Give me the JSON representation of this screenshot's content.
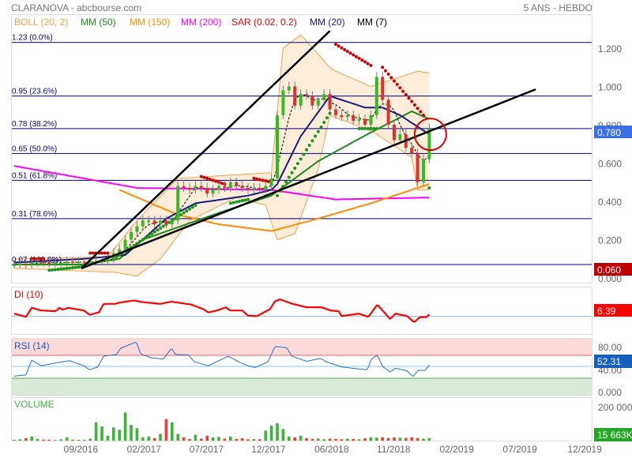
{
  "header": {
    "title": "CLARANOVA - abcbourse.com",
    "period": "5 ANS - HEBDO"
  },
  "legend": [
    {
      "label": "BOLL (20, 2)",
      "color": "#f5a04a"
    },
    {
      "label": "MM (50)",
      "color": "#1a8a1a"
    },
    {
      "label": "MM (150)",
      "color": "#ff8c00"
    },
    {
      "label": "MM (200)",
      "color": "#ff00ff"
    },
    {
      "label": "SAR (0.02, 0.2)",
      "color": "#e00000"
    },
    {
      "label": "MM (20)",
      "color": "#1a1a80"
    },
    {
      "label": "MM (7)",
      "color": "#000000"
    }
  ],
  "badges": {
    "last_price": "0.780",
    "last_price_color": "#3a6fe8",
    "sar": "0.060",
    "sar_color": "#c00000",
    "di": "6.39",
    "di_color": "#ff0000",
    "rsi": "52.31",
    "rsi_color": "#1560bd",
    "volume": "15 663K",
    "volume_color": "#22a822"
  },
  "panels": {
    "di": "DI (10)",
    "rsi": "RSI (14)",
    "volume": "VOLUME"
  },
  "chart_data": {
    "type": "candlestick",
    "title": "CLARANOVA - abcbourse.com",
    "x_unit": "bi-weekly index",
    "x_ticks": [
      {
        "label": "09/2016",
        "i": 11.4
      },
      {
        "label": "02/2017",
        "i": 22.2
      },
      {
        "label": "07/2017",
        "i": 32.9
      },
      {
        "label": "12/2017",
        "i": 43.5
      },
      {
        "label": "06/2018",
        "i": 54.3
      },
      {
        "label": "11/2018",
        "i": 64.9
      },
      {
        "label": "02/2019",
        "i": 75.7
      },
      {
        "label": "07/2019",
        "i": 86.5
      },
      {
        "label": "12/2019",
        "i": 97.6
      }
    ],
    "y_ticks": [
      "0.000",
      "0.200",
      "0.400",
      "0.600",
      "0.800",
      "1.000",
      "1.200"
    ],
    "ylim": [
      0,
      1.3
    ],
    "close": [
      0.07,
      0.075,
      0.07,
      0.08,
      0.085,
      0.08,
      0.075,
      0.08,
      0.08,
      0.085,
      0.08,
      0.085,
      0.08,
      0.085,
      0.09,
      0.09,
      0.1,
      0.13,
      0.15,
      0.2,
      0.24,
      0.27,
      0.3,
      0.3,
      0.28,
      0.3,
      0.28,
      0.3,
      0.48,
      0.47,
      0.46,
      0.48,
      0.47,
      0.44,
      0.46,
      0.48,
      0.47,
      0.5,
      0.48,
      0.47,
      0.46,
      0.47,
      0.46,
      0.48,
      0.52,
      0.85,
      0.98,
      1.0,
      0.9,
      0.96,
      0.95,
      0.9,
      0.93,
      0.96,
      0.88,
      0.85,
      0.84,
      0.85,
      0.82,
      0.83,
      0.8,
      0.85,
      1.05,
      0.93,
      0.8,
      0.72,
      0.75,
      0.68,
      0.65,
      0.5,
      0.62,
      0.78
    ],
    "fibonacci": [
      {
        "label": "1.23  (0.0%)",
        "value": 1.23
      },
      {
        "label": "0.95  (23.6%)",
        "value": 0.95
      },
      {
        "label": "0.78  (38.2%)",
        "value": 0.78
      },
      {
        "label": "0.65  (50.0%)",
        "value": 0.65
      },
      {
        "label": "0.51  (61.8%)",
        "value": 0.51
      },
      {
        "label": "0.31  (78.6%)",
        "value": 0.31
      },
      {
        "label": "0.07  (100.0%)",
        "value": 0.07
      }
    ],
    "boll_upper": [
      [
        0,
        0.1
      ],
      [
        16,
        0.11
      ],
      [
        21,
        0.3
      ],
      [
        28,
        0.52
      ],
      [
        44,
        0.55
      ],
      [
        46,
        1.2
      ],
      [
        49,
        1.27
      ],
      [
        54,
        1.1
      ],
      [
        55,
        1.08
      ],
      [
        61,
        1.0
      ],
      [
        69,
        1.08
      ],
      [
        71,
        1.07
      ]
    ],
    "boll_lower": [
      [
        0,
        0.05
      ],
      [
        17,
        0.03
      ],
      [
        21,
        0.01
      ],
      [
        25,
        0.1
      ],
      [
        30,
        0.3
      ],
      [
        38,
        0.42
      ],
      [
        43,
        0.38
      ],
      [
        45,
        0.2
      ],
      [
        48,
        0.23
      ],
      [
        52,
        0.57
      ],
      [
        54,
        0.85
      ],
      [
        61,
        0.77
      ],
      [
        68,
        0.63
      ],
      [
        69,
        0.46
      ],
      [
        71,
        0.46
      ]
    ],
    "mm50": [
      [
        0,
        0.07
      ],
      [
        12,
        0.07
      ],
      [
        18,
        0.1
      ],
      [
        22,
        0.2
      ],
      [
        35,
        0.34
      ],
      [
        44,
        0.43
      ],
      [
        52,
        0.61
      ],
      [
        61,
        0.76
      ],
      [
        68,
        0.87
      ],
      [
        71,
        0.83
      ]
    ],
    "mm150": [
      [
        18,
        0.46
      ],
      [
        28,
        0.33
      ],
      [
        35,
        0.28
      ],
      [
        44,
        0.245
      ],
      [
        52,
        0.31
      ],
      [
        61,
        0.39
      ],
      [
        71,
        0.49
      ]
    ],
    "mm200": [
      [
        0,
        0.585
      ],
      [
        21,
        0.47
      ],
      [
        44,
        0.46
      ],
      [
        55,
        0.41
      ],
      [
        71,
        0.42
      ]
    ],
    "mm20": [
      [
        0,
        0.08
      ],
      [
        12,
        0.1
      ],
      [
        19,
        0.12
      ],
      [
        26,
        0.31
      ],
      [
        31,
        0.39
      ],
      [
        40,
        0.43
      ],
      [
        44,
        0.46
      ],
      [
        45,
        0.49
      ],
      [
        49,
        0.74
      ],
      [
        54,
        0.95
      ],
      [
        60,
        0.89
      ],
      [
        63,
        0.89
      ],
      [
        66,
        0.85
      ],
      [
        71,
        0.75
      ]
    ],
    "sar": [
      {
        "color": "red",
        "from": 3,
        "to": 5,
        "start": 0.1,
        "end": 0.1
      },
      {
        "color": "green",
        "from": 6,
        "to": 12,
        "start": 0.04,
        "end": 0.06
      },
      {
        "color": "red",
        "from": 13,
        "to": 16,
        "start": 0.13,
        "end": 0.13
      },
      {
        "color": "green",
        "from": 17,
        "to": 31,
        "start": 0.1,
        "end": 0.38
      },
      {
        "color": "red",
        "from": 32,
        "to": 36,
        "start": 0.53,
        "end": 0.49
      },
      {
        "color": "green",
        "from": 37,
        "to": 40,
        "start": 0.39,
        "end": 0.41
      },
      {
        "color": "red",
        "from": 41,
        "to": 44,
        "start": 0.52,
        "end": 0.5
      },
      {
        "color": "green",
        "from": 45,
        "to": 54,
        "start": 0.43,
        "end": 0.86
      },
      {
        "color": "red",
        "from": 55,
        "to": 61,
        "start": 1.22,
        "end": 1.11
      },
      {
        "color": "green",
        "from": 59,
        "to": 62,
        "start": 0.78,
        "end": 0.78
      },
      {
        "color": "red",
        "from": 63,
        "to": 70,
        "start": 1.1,
        "end": 0.85
      },
      {
        "color": "green",
        "from": 71,
        "to": 71,
        "start": 0.47,
        "end": 0.47
      }
    ],
    "trendlines": [
      {
        "from": [
          11.5,
          0.05
        ],
        "to": [
          54,
          1.29
        ]
      },
      {
        "from": [
          11.5,
          0.05
        ],
        "to": [
          89.2,
          0.985
        ]
      }
    ],
    "highlight_circle": {
      "i": 71.2,
      "value": 0.75
    },
    "di": [
      [
        0,
        9
      ],
      [
        2,
        -4
      ],
      [
        3,
        33
      ],
      [
        4.6,
        22
      ],
      [
        7,
        19
      ],
      [
        7.8,
        33
      ],
      [
        8.3,
        25
      ],
      [
        9.2,
        33
      ],
      [
        11.9,
        22
      ],
      [
        12.9,
        4
      ],
      [
        14.5,
        15
      ],
      [
        15.3,
        49
      ],
      [
        17.2,
        49
      ],
      [
        18.2,
        55
      ],
      [
        20.6,
        63
      ],
      [
        21.6,
        57
      ],
      [
        25,
        49
      ],
      [
        26.9,
        58
      ],
      [
        30.3,
        46
      ],
      [
        32.3,
        28
      ],
      [
        33.2,
        14
      ],
      [
        34.7,
        22
      ],
      [
        36.2,
        35
      ],
      [
        36.9,
        22
      ],
      [
        39,
        22
      ],
      [
        40,
        1
      ],
      [
        41.5,
        -1
      ],
      [
        43.8,
        28
      ],
      [
        44.6,
        60
      ],
      [
        45.5,
        67
      ],
      [
        47.6,
        49
      ],
      [
        50,
        35
      ],
      [
        52.6,
        35
      ],
      [
        54.1,
        22
      ],
      [
        55.5,
        19
      ],
      [
        56,
        -1
      ],
      [
        58.9,
        9
      ],
      [
        60.6,
        -4
      ],
      [
        62.1,
        46
      ],
      [
        64.3,
        -13
      ],
      [
        65.2,
        9
      ],
      [
        67.2,
        -1
      ],
      [
        68.4,
        -26
      ],
      [
        69.4,
        -5
      ],
      [
        70.6,
        -5
      ],
      [
        71,
        6.39
      ]
    ],
    "rsi": [
      [
        0,
        33
      ],
      [
        2,
        35
      ],
      [
        3,
        61
      ],
      [
        4.6,
        51
      ],
      [
        7.5,
        57
      ],
      [
        9.5,
        60
      ],
      [
        11.9,
        51
      ],
      [
        12.9,
        44
      ],
      [
        14.3,
        49
      ],
      [
        15.3,
        68
      ],
      [
        17.5,
        71
      ],
      [
        18.2,
        82
      ],
      [
        20.9,
        93
      ],
      [
        21.6,
        72
      ],
      [
        23.5,
        65
      ],
      [
        25.5,
        63
      ],
      [
        26.9,
        82
      ],
      [
        27.6,
        71
      ],
      [
        29.8,
        70
      ],
      [
        30.8,
        58
      ],
      [
        33.2,
        51
      ],
      [
        36.6,
        68
      ],
      [
        38.6,
        57
      ],
      [
        40,
        51
      ],
      [
        41.2,
        48
      ],
      [
        43.4,
        58
      ],
      [
        44.6,
        85
      ],
      [
        46.6,
        83
      ],
      [
        47.5,
        68
      ],
      [
        50,
        59
      ],
      [
        52.4,
        64
      ],
      [
        53.4,
        58
      ],
      [
        56,
        49
      ],
      [
        60.4,
        44
      ],
      [
        61.1,
        63
      ],
      [
        62.1,
        70
      ],
      [
        63,
        50
      ],
      [
        64.3,
        40
      ],
      [
        65.2,
        47
      ],
      [
        67.2,
        42
      ],
      [
        68.2,
        32
      ],
      [
        69.1,
        43
      ],
      [
        70.3,
        43
      ],
      [
        71,
        52.31
      ]
    ],
    "rsi_levels": {
      "overbought": 70,
      "mid": 50,
      "oversold": 30
    },
    "rsi_ticks": [
      "80.00",
      "40.00",
      "0.000"
    ],
    "volume_k": [
      5,
      8,
      15,
      25,
      10,
      6,
      5,
      4,
      8,
      20,
      6,
      5,
      4,
      12,
      110,
      85,
      30,
      80,
      65,
      170,
      95,
      75,
      20,
      25,
      15,
      40,
      130,
      110,
      40,
      20,
      10,
      35,
      12,
      30,
      20,
      22,
      12,
      25,
      10,
      14,
      8,
      10,
      8,
      60,
      90,
      105,
      70,
      25,
      20,
      30,
      15,
      10,
      12,
      8,
      12,
      10,
      8,
      12,
      10,
      8,
      14,
      20,
      18,
      20,
      15,
      20,
      18,
      16,
      20,
      15,
      12,
      15.663
    ],
    "volume_ticks": [
      "200 000"
    ]
  }
}
